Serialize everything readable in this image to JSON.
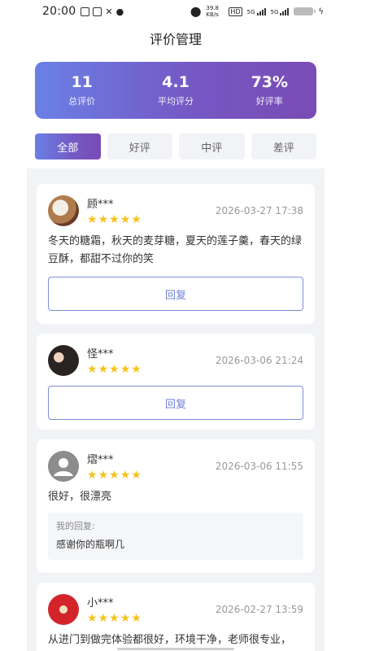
{
  "status_bar": {
    "time": "20:00",
    "net_speed": "39.8 KB/s",
    "hd": "HD",
    "sig1": "5G",
    "sig2": "5G"
  },
  "header": {
    "title": "评价管理"
  },
  "stats": [
    {
      "value": "11",
      "label": "总评价"
    },
    {
      "value": "4.1",
      "label": "平均评分"
    },
    {
      "value": "73%",
      "label": "好评率"
    }
  ],
  "tabs": [
    {
      "label": "全部",
      "active": true
    },
    {
      "label": "好评",
      "active": false
    },
    {
      "label": "中评",
      "active": false
    },
    {
      "label": "差评",
      "active": false
    }
  ],
  "reviews": [
    {
      "user": "顾***",
      "rating": 5,
      "date": "2026-03-27 17:38",
      "content": "冬天的糖霜，秋天的麦芽糖，夏天的莲子羹，春天的绿豆酥，都甜不过你的笑",
      "reply_button": "回复"
    },
    {
      "user": "怪***",
      "rating": 5,
      "date": "2026-03-06 21:24",
      "content": "",
      "reply_button": "回复"
    },
    {
      "user": "熠***",
      "rating": 5,
      "date": "2026-03-06 11:55",
      "content": "很好，很漂亮",
      "my_reply_label": "我的回复:",
      "my_reply_text": "感谢你的瓶啊几"
    },
    {
      "user": "小***",
      "rating": 5,
      "date": "2026-02-27 13:59",
      "content": "从进门到做完体验都很好，环境干净，老师很专业，"
    }
  ],
  "star_char": "★",
  "colors": {
    "accent_start": "#6a80e6",
    "accent_end": "#7a4bb4",
    "star": "#f7c21b",
    "reply_border": "#7c8ed8"
  }
}
